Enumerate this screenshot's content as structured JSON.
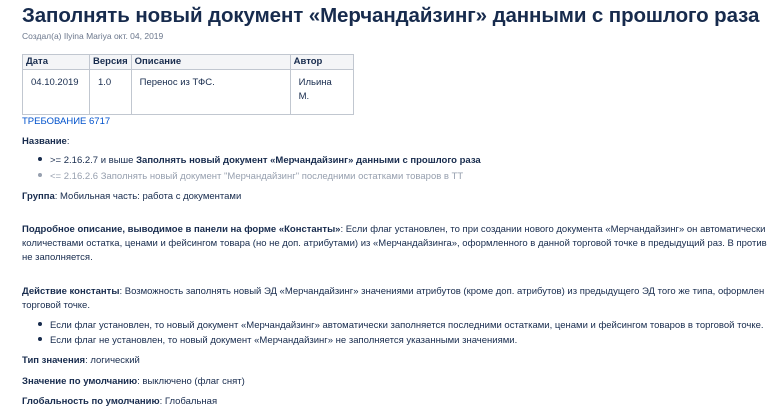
{
  "title": "Заполнять новый документ «Мерчандайзинг» данными с прошлого раза",
  "byline": "Создал(а) Ilyina Mariya окт. 04, 2019",
  "history_table": {
    "headers": [
      "Дата",
      "Версия",
      "Описание",
      "Автор"
    ],
    "rows": [
      {
        "date": "04.10.2019",
        "version": "1.0",
        "description": "Перенос из ТФС.",
        "author_line1": "Ильина",
        "author_line2": "М."
      }
    ]
  },
  "requirement_link": "ТРЕБОВАНИЕ 6717",
  "name_section": {
    "label": "Название",
    "colon": ":",
    "items": [
      {
        "prefix": ">= 2.16.2.7 и выше ",
        "bold": "Заполнять новый документ «Мерчандайзинг» данными с прошлого раза"
      },
      {
        "text": "<= 2.16.2.6 Заполнять новый документ \"Мерчандайзинг\" последними остатками товаров в ТТ"
      }
    ]
  },
  "group": {
    "label": "Группа",
    "value": ": Мобильная часть: работа с документами"
  },
  "detailed_description": {
    "label": "Подробное описание, выводимое в панели на форме «Константы»",
    "line1": ": Если флаг установлен, то при создании нового документа «Мерчандайзинг» он автоматически",
    "line2": "количествами остатка, ценами и фейсингом товара (но не доп. атрибутами) из «Мерчандайзинга», оформленного в данной торговой точке в предыдущий раз. В против",
    "line3": "не заполняется."
  },
  "constant_action": {
    "label": "Действие константы",
    "line1": ": Возможность заполнять новый ЭД «Мерчандайзинг» значениями атрибутов (кроме доп. атрибутов) из предыдущего ЭД того же типа, оформлен",
    "line2": "торговой точке.",
    "items": [
      "Если флаг установлен, то новый документ «Мерчандайзинг» автоматически заполняется последними остатками, ценами и фейсингом товаров в торговой точке.",
      "Если флаг не установлен, то новый документ «Мерчандайзинг» не заполняется указанными значениями."
    ]
  },
  "value_type": {
    "label": "Тип значения",
    "value": ": логический"
  },
  "default_value": {
    "label": "Значение по умолчанию",
    "value": ": выключено (флаг снят)"
  },
  "default_globality": {
    "label": "Глобальность по умолчанию",
    "value": ": Глобальная"
  }
}
